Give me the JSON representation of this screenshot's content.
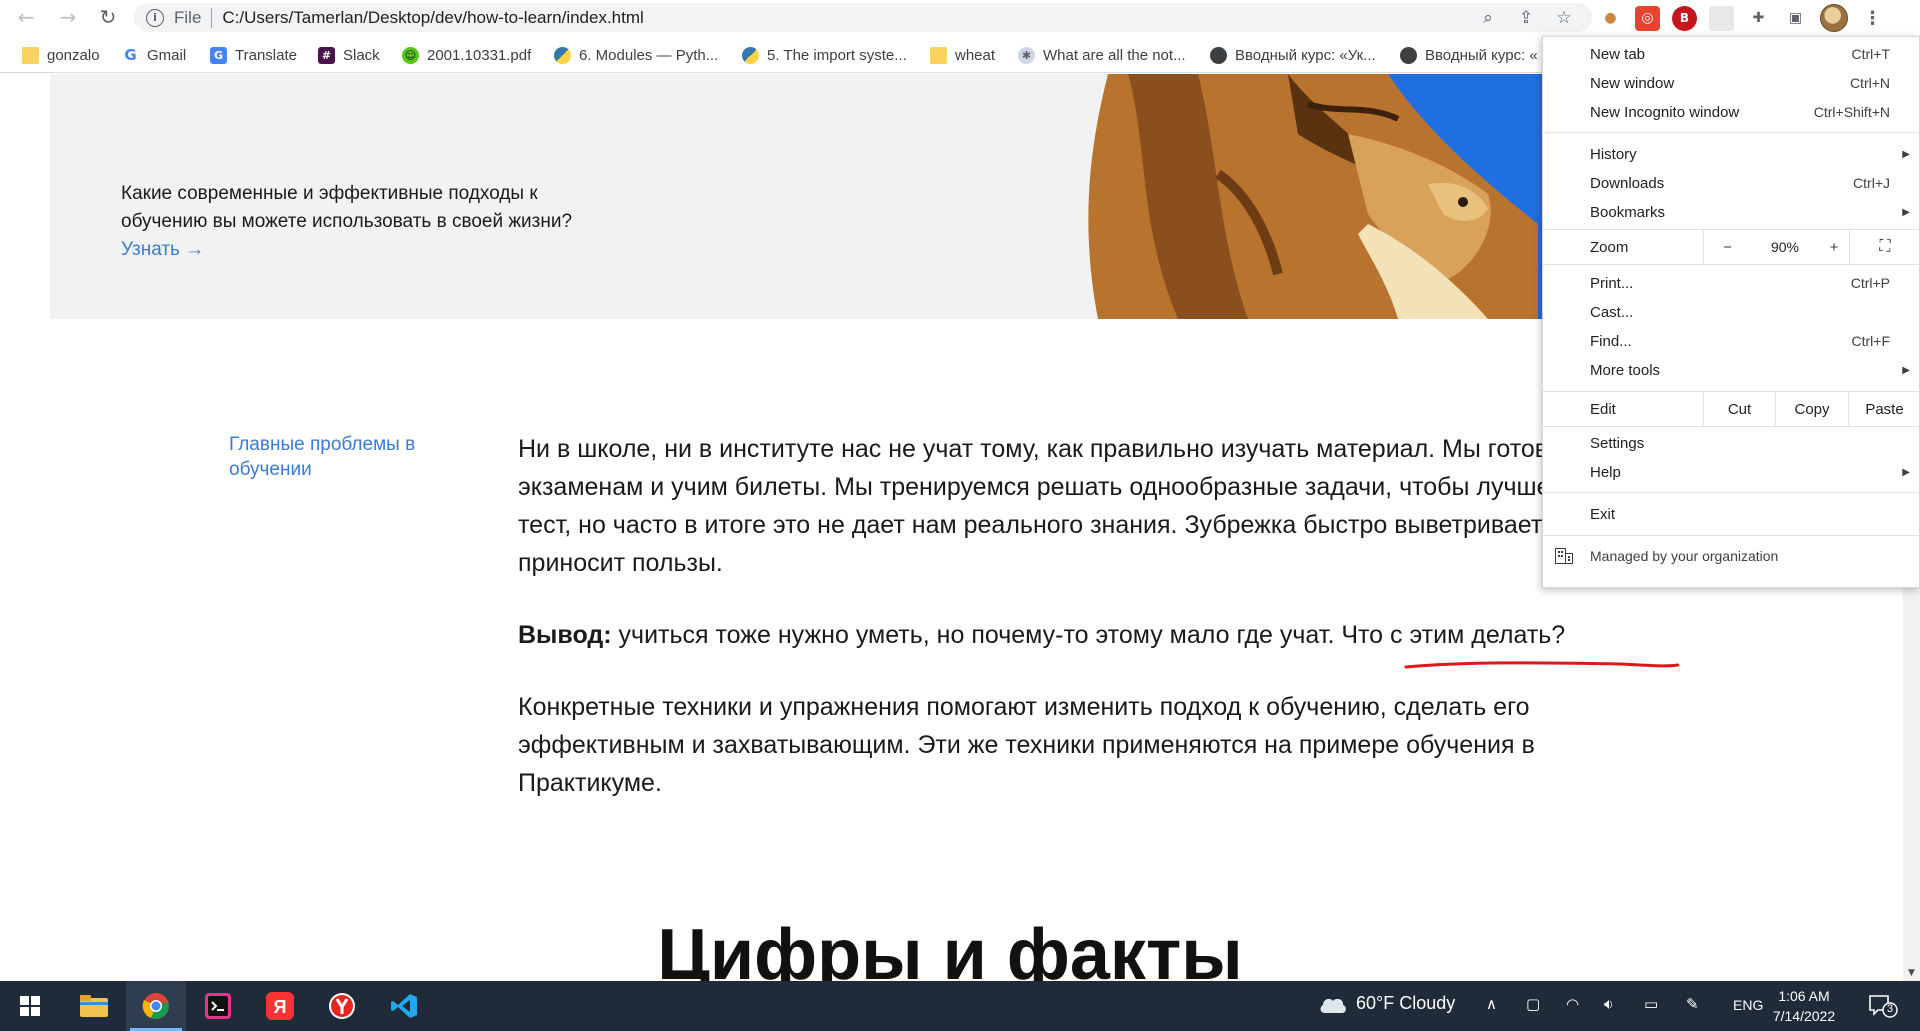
{
  "browser": {
    "url_scheme": "File",
    "url": "C:/Users/Tamerlan/Desktop/dev/how-to-learn/index.html",
    "bookmarks": [
      {
        "label": "gonzalo",
        "icon": "folder-icon"
      },
      {
        "label": "Gmail",
        "icon": "google-icon"
      },
      {
        "label": "Translate",
        "icon": "translate-icon"
      },
      {
        "label": "Slack",
        "icon": "slack-icon"
      },
      {
        "label": "2001.10331.pdf",
        "icon": "smiley-icon"
      },
      {
        "label": "6. Modules — Pyth...",
        "icon": "python-icon"
      },
      {
        "label": "5. The import syste...",
        "icon": "python-icon"
      },
      {
        "label": "wheat",
        "icon": "folder-icon"
      },
      {
        "label": "What are all the not...",
        "icon": "globe-icon"
      },
      {
        "label": "Вводный курс: «Ук...",
        "icon": "world-icon"
      },
      {
        "label": "Вводный курс: «",
        "icon": "world-icon"
      }
    ]
  },
  "page": {
    "hero_text": "Какие современные и эффективные подходы к обучению вы можете использовать в своей жизни?",
    "hero_link": "Узнать →",
    "toc_link": "Главные проблемы в обучении",
    "paragraph1": "Ни в школе, ни в институте нас не учат тому, как правильно изучать материал. Мы готовимся к экзаменам и учим билеты. Мы тренируемся решать однообразные задачи, чтобы лучше сдать тест, но часто в итоге это не дает нам реального знания. Зубрежка быстро выветривается и не приносит пользы.",
    "conclusion_label": "Вывод:",
    "conclusion_text": "учиться тоже нужно уметь, но почему-то этому мало где учат. Что с этим делать?",
    "paragraph3": "Конкретные техники и упражнения помогают изменить подход к обучению, сделать его эффективным и захватывающим. Эти же техники применяются на примере обучения в Практикуме.",
    "section_title": "Цифры и факты"
  },
  "menu": {
    "new_tab": "New tab",
    "new_tab_sc": "Ctrl+T",
    "new_window": "New window",
    "new_window_sc": "Ctrl+N",
    "incognito": "New Incognito window",
    "incognito_sc": "Ctrl+Shift+N",
    "history": "History",
    "downloads": "Downloads",
    "downloads_sc": "Ctrl+J",
    "bookmarks": "Bookmarks",
    "zoom": "Zoom",
    "zoom_minus": "−",
    "zoom_value": "90%",
    "zoom_plus": "+",
    "print": "Print...",
    "print_sc": "Ctrl+P",
    "cast": "Cast...",
    "find": "Find...",
    "find_sc": "Ctrl+F",
    "more_tools": "More tools",
    "edit": "Edit",
    "cut": "Cut",
    "copy": "Copy",
    "paste": "Paste",
    "settings": "Settings",
    "help": "Help",
    "exit": "Exit",
    "managed": "Managed by your organization"
  },
  "taskbar": {
    "weather": "60°F  Cloudy",
    "lang": "ENG",
    "time": "1:06 AM",
    "date": "7/14/2022",
    "notifications": "3"
  },
  "colors": {
    "link": "#3a7bd5",
    "annotation": "#e0161c",
    "taskbar": "#1f2b38"
  }
}
